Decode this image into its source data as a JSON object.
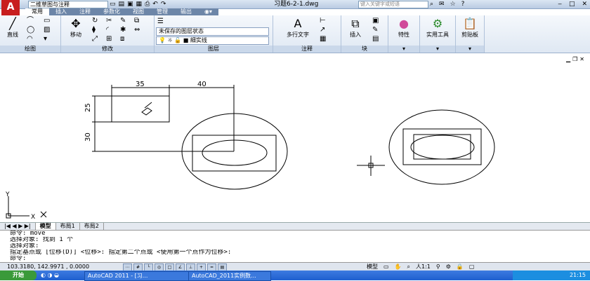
{
  "titlebar": {
    "workspace": "二维草图与注释",
    "document_title": "习题6-2-1.dwg",
    "search_placeholder": "键入关键字或短语"
  },
  "tabs": [
    "常用",
    "插入",
    "注释",
    "参数化",
    "视图",
    "管理",
    "输出"
  ],
  "ribbon": {
    "draw": {
      "label": "绘图",
      "line": "直线"
    },
    "modify": {
      "label": "修改",
      "move": "移动"
    },
    "layers": {
      "label": "图层",
      "state": "未保存的图层状态",
      "current": "細实线"
    },
    "annotation": {
      "label": "注释",
      "mtext": "多行文字"
    },
    "block": {
      "label": "块",
      "insert": "插入"
    },
    "properties": {
      "label": "特性"
    },
    "utilities": {
      "label": "实用工具"
    },
    "clipboard": {
      "label": "剪贴板"
    }
  },
  "drawing": {
    "dim_top_left": "35",
    "dim_top_right": "40",
    "dim_left_top": "25",
    "dim_left_bottom": "30"
  },
  "ucs": {
    "y": "Y",
    "x": "X"
  },
  "layout_tabs": [
    "模型",
    "布局1",
    "布局2"
  ],
  "command_lines": [
    "命令:  move",
    "选择对象: 找到 1 个",
    "选择对象:",
    "指定基点或 [位移(D)] <位移>:  指定第二个点或 <使用第一个点作为位移>:",
    "命令:"
  ],
  "status": {
    "coords": "103.3180, 142.9971 , 0.0000",
    "model": "模型",
    "scale": "人1:1"
  },
  "taskbar": {
    "start": "开始",
    "tasks": [
      "AutoCAD 2011 - [习...",
      "AutoCAD_2011实例数..."
    ],
    "clock": "21:15"
  }
}
